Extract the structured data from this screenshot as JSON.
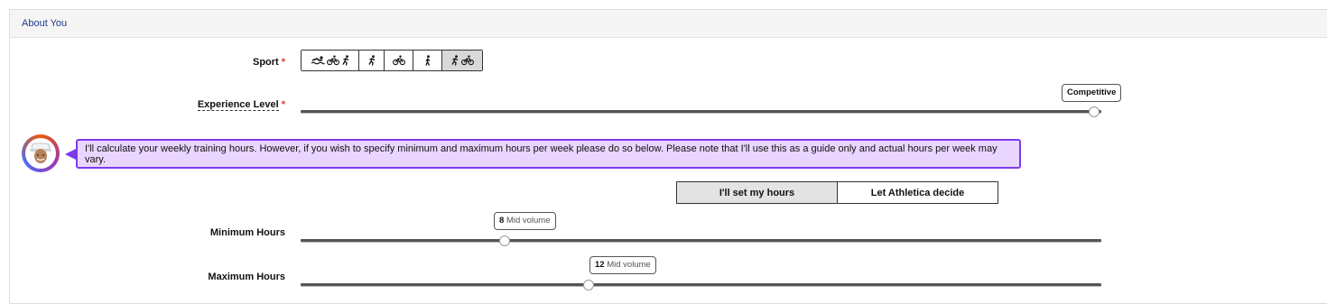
{
  "section": {
    "title": "About You"
  },
  "sport": {
    "label": "Sport",
    "required_mark": "*",
    "options": [
      {
        "name": "triathlon",
        "icons": [
          "swim-icon",
          "bike-icon",
          "run-icon"
        ],
        "selected": false
      },
      {
        "name": "run",
        "icons": [
          "run-icon"
        ],
        "selected": false
      },
      {
        "name": "bike",
        "icons": [
          "bike-icon"
        ],
        "selected": false
      },
      {
        "name": "walk",
        "icons": [
          "walk-icon"
        ],
        "selected": false
      },
      {
        "name": "duathlon",
        "icons": [
          "run-icon",
          "bike-icon"
        ],
        "selected": true
      }
    ]
  },
  "experience": {
    "label": "Experience Level",
    "required_mark": "*",
    "value_label": "Competitive",
    "level": 1.0
  },
  "coach": {
    "message": "I'll calculate your weekly training hours. However, if you wish to specify minimum and maximum hours per week please do so below. Please note that I'll use this as a guide only and actual hours per week may vary."
  },
  "hours_mode": {
    "set_label": "I'll set my hours",
    "auto_label": "Let Athletica decide",
    "selected": "set"
  },
  "min_hours": {
    "label": "Minimum Hours",
    "value": "8",
    "volume": "Mid volume"
  },
  "max_hours": {
    "label": "Maximum Hours",
    "value": "12",
    "volume": "Mid volume"
  },
  "colors": {
    "bubble_bg": "#e9d5ff",
    "bubble_border": "#7c3aed",
    "required": "#e03131",
    "title": "#1f3a8a"
  }
}
